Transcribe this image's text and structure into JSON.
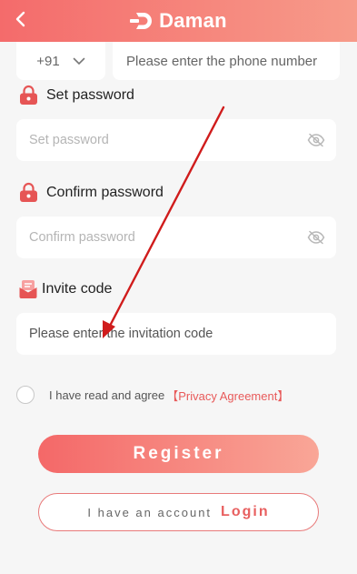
{
  "header": {
    "back_icon": "chevron-left-icon",
    "brand": "Daman",
    "logo_icon": "daman-logo-icon"
  },
  "phone": {
    "country_code": "+91",
    "country_icon": "chevron-down-icon",
    "placeholder": "Please enter the phone number"
  },
  "set_password": {
    "label": "Set password",
    "icon": "lock-icon",
    "placeholder": "Set password",
    "eye_icon": "eye-off-icon"
  },
  "confirm_password": {
    "label": "Confirm password",
    "icon": "lock-icon",
    "placeholder": "Confirm password",
    "eye_icon": "eye-off-icon"
  },
  "invite": {
    "label": "Invite code",
    "icon": "invitation-icon",
    "placeholder": "Please enter the invitation code"
  },
  "agreement": {
    "text": "I have read and agree",
    "link": "【Privacy Agreement】"
  },
  "register_button": "Register",
  "login_row": {
    "prefix": "I have an account",
    "link": "Login"
  },
  "colors": {
    "accent": "#f46b6b",
    "annotation_arrow": "#d01c1c"
  }
}
